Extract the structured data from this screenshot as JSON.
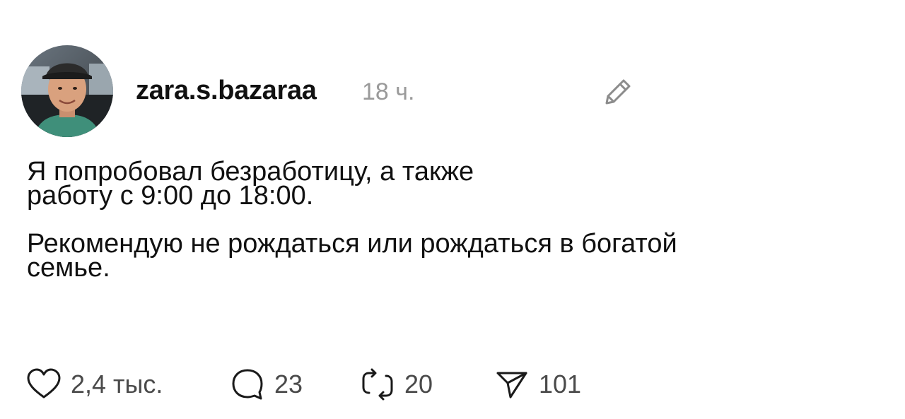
{
  "post": {
    "author": {
      "username": "zara.s.bazaraa",
      "avatar_icon": "user-avatar-photo"
    },
    "timestamp": "18 ч.",
    "edit_icon": "pencil-icon",
    "text": {
      "paragraph1": "Я попробовал безработицу, а также\nработу с 9:00 до 18:00.",
      "paragraph2": "Рекомендую не рождаться или рождаться в богатой\nсемье."
    },
    "actions": {
      "likes": {
        "icon": "heart-icon",
        "count": "2,4 тыс."
      },
      "replies": {
        "icon": "comment-icon",
        "count": "23"
      },
      "reposts": {
        "icon": "repost-icon",
        "count": "20"
      },
      "shares": {
        "icon": "send-icon",
        "count": "101"
      }
    }
  },
  "colors": {
    "text": "#111111",
    "muted": "#9a9a9a",
    "counts": "#4a4a4a",
    "background": "#ffffff"
  }
}
